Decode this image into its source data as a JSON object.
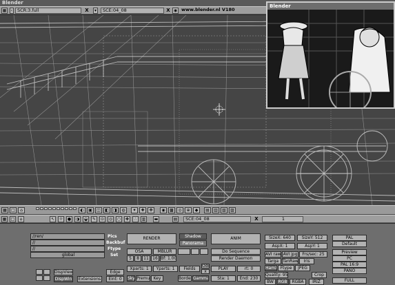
{
  "window_title": "Blender",
  "top_header": {
    "screen_field": "SCR:3.full",
    "scene_field": "SCE:04_08",
    "url": "www.blender.nl V180"
  },
  "render_window": {
    "title": "Blender"
  },
  "mid_header": {
    "scene_field": "SCE:04_08",
    "frame": "1"
  },
  "render_panel": {
    "paths": [
      {
        "value": "//ren/",
        "button": "Pics"
      },
      {
        "value": "//",
        "button": "Backbuf"
      },
      {
        "value": "//",
        "button": "Ftype"
      }
    ],
    "global_field": "global",
    "set_label": "Set",
    "render_button": "RENDER",
    "osa": "OSA",
    "mblur": "MBLUR",
    "osa_values": [
      "5",
      "8",
      "11",
      "16"
    ],
    "bf": "Bf: 1.000",
    "shadow": "Shadow",
    "pano": "Panorama",
    "anim_button": "ANIM",
    "do_sequence": "Do Sequence",
    "render_daemon": "Render Daemon",
    "xparts": "Xparts: 1",
    "yparts": "Yparts: 1",
    "fields": "Fields",
    "odd": "Odd",
    "x": "x",
    "sky": "Sky",
    "premul": "Premul",
    "key": "Key",
    "border": "Border",
    "gamma": "Gamma",
    "play": "PLAY",
    "rt": "rt: 0",
    "sta": "Sta: 1",
    "end": "End: 230",
    "edge": "Edge",
    "eint": "Eint: 0",
    "dispview": "DispView",
    "dispwin": "DispWin",
    "extensions": "Extensions",
    "sizex": "SizeX: 640",
    "sizey": "SizeY: 512",
    "aspx": "AspX: 1",
    "aspy": "AspY: 1",
    "avi_raw": "AVI raw",
    "avi_jpg": "AVI jpg",
    "frs_sec": "Frs/sec: 25",
    "targa": "Targa",
    "tanalsel": "TanRaw",
    "iris": "Iris",
    "hamx": "HamX",
    "ftype": "Ftype",
    "jpeg": "JPEG",
    "quality": "Quality: 95",
    "crop": "Crop",
    "bw": "BW",
    "rgb": "RGB",
    "rgba": "RGBA",
    "iriz": "IRIZ",
    "presets": [
      "PAL",
      "Default",
      "Preview",
      "PC",
      "PAL 16:9",
      "PANO",
      "FULL"
    ]
  }
}
